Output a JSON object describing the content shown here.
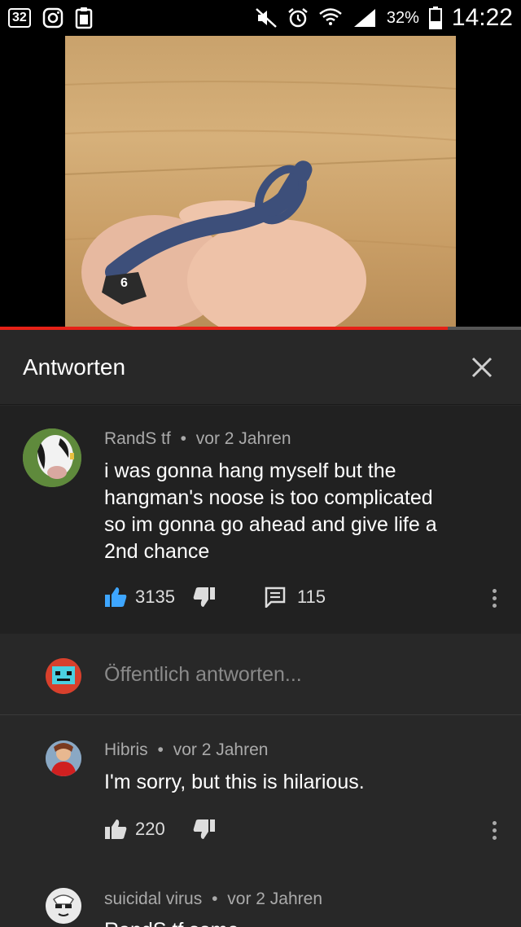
{
  "status_bar": {
    "notification_count": "32",
    "battery_percent": "32%",
    "time": "14:22"
  },
  "video": {
    "step_marker": "6",
    "progress_fraction": 0.86
  },
  "panel": {
    "title": "Antworten"
  },
  "main_comment": {
    "author": "RandS tf",
    "separator": "•",
    "time": "vor 2 Jahren",
    "text_lines": [
      "i was gonna hang myself but the",
      "hangman's noose is too complicated",
      "so im gonna go ahead and give life a",
      "2nd chance"
    ],
    "likes": "3135",
    "replies": "115",
    "like_color": "#3ea6ff"
  },
  "reply_box": {
    "placeholder": "Öffentlich antworten..."
  },
  "replies": [
    {
      "author": "Hibris",
      "separator": "•",
      "time": "vor 2 Jahren",
      "text": "I'm sorry, but this is hilarious.",
      "likes": "220"
    },
    {
      "author": "suicidal virus",
      "separator": "•",
      "time": "vor 2 Jahren",
      "text": "RandS tf some"
    }
  ]
}
